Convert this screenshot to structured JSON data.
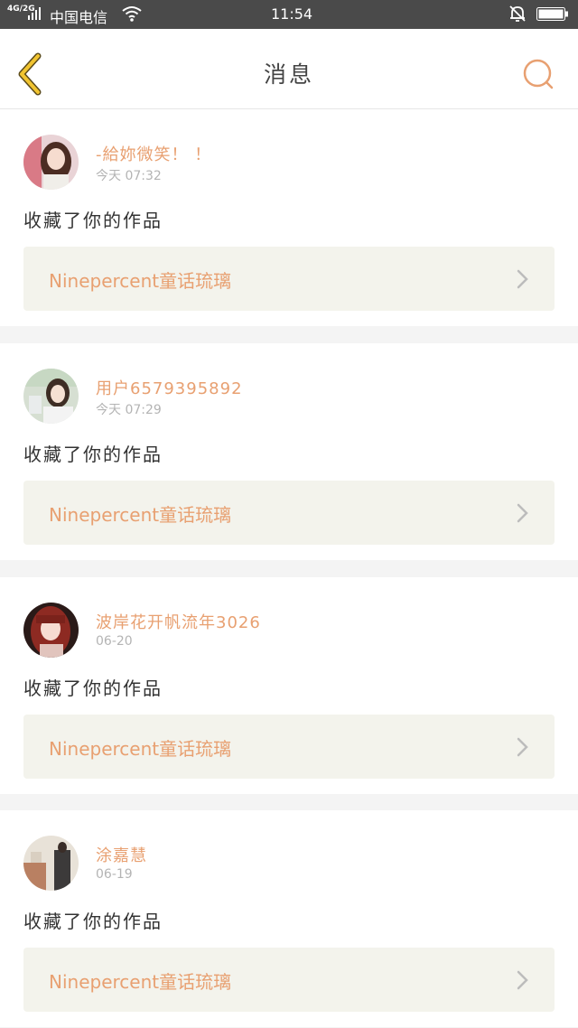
{
  "status_bar": {
    "network": "4G/2G",
    "carrier": "中国电信",
    "time": "11:54",
    "icons": [
      "signal-icon",
      "wifi-icon",
      "bell-muted-icon",
      "battery-icon"
    ]
  },
  "header": {
    "title": "消息",
    "back_icon": "chevron-left-icon",
    "search_icon": "search-icon",
    "accent_color": "#e8a071",
    "back_color": "#f1c431"
  },
  "messages": [
    {
      "username": "-給妳微笑！ ！",
      "time": "今天 07:32",
      "action": "收藏了你的作品",
      "work_title": "Ninepercent童话琉璃"
    },
    {
      "username": "用户6579395892",
      "time": "今天 07:29",
      "action": "收藏了你的作品",
      "work_title": "Ninepercent童话琉璃"
    },
    {
      "username": "波岸花开帆流年3026",
      "time": "06-20",
      "action": "收藏了你的作品",
      "work_title": "Ninepercent童话琉璃"
    },
    {
      "username": "涂嘉慧",
      "time": "06-19",
      "action": "收藏了你的作品",
      "work_title": "Ninepercent童话琉璃"
    }
  ]
}
